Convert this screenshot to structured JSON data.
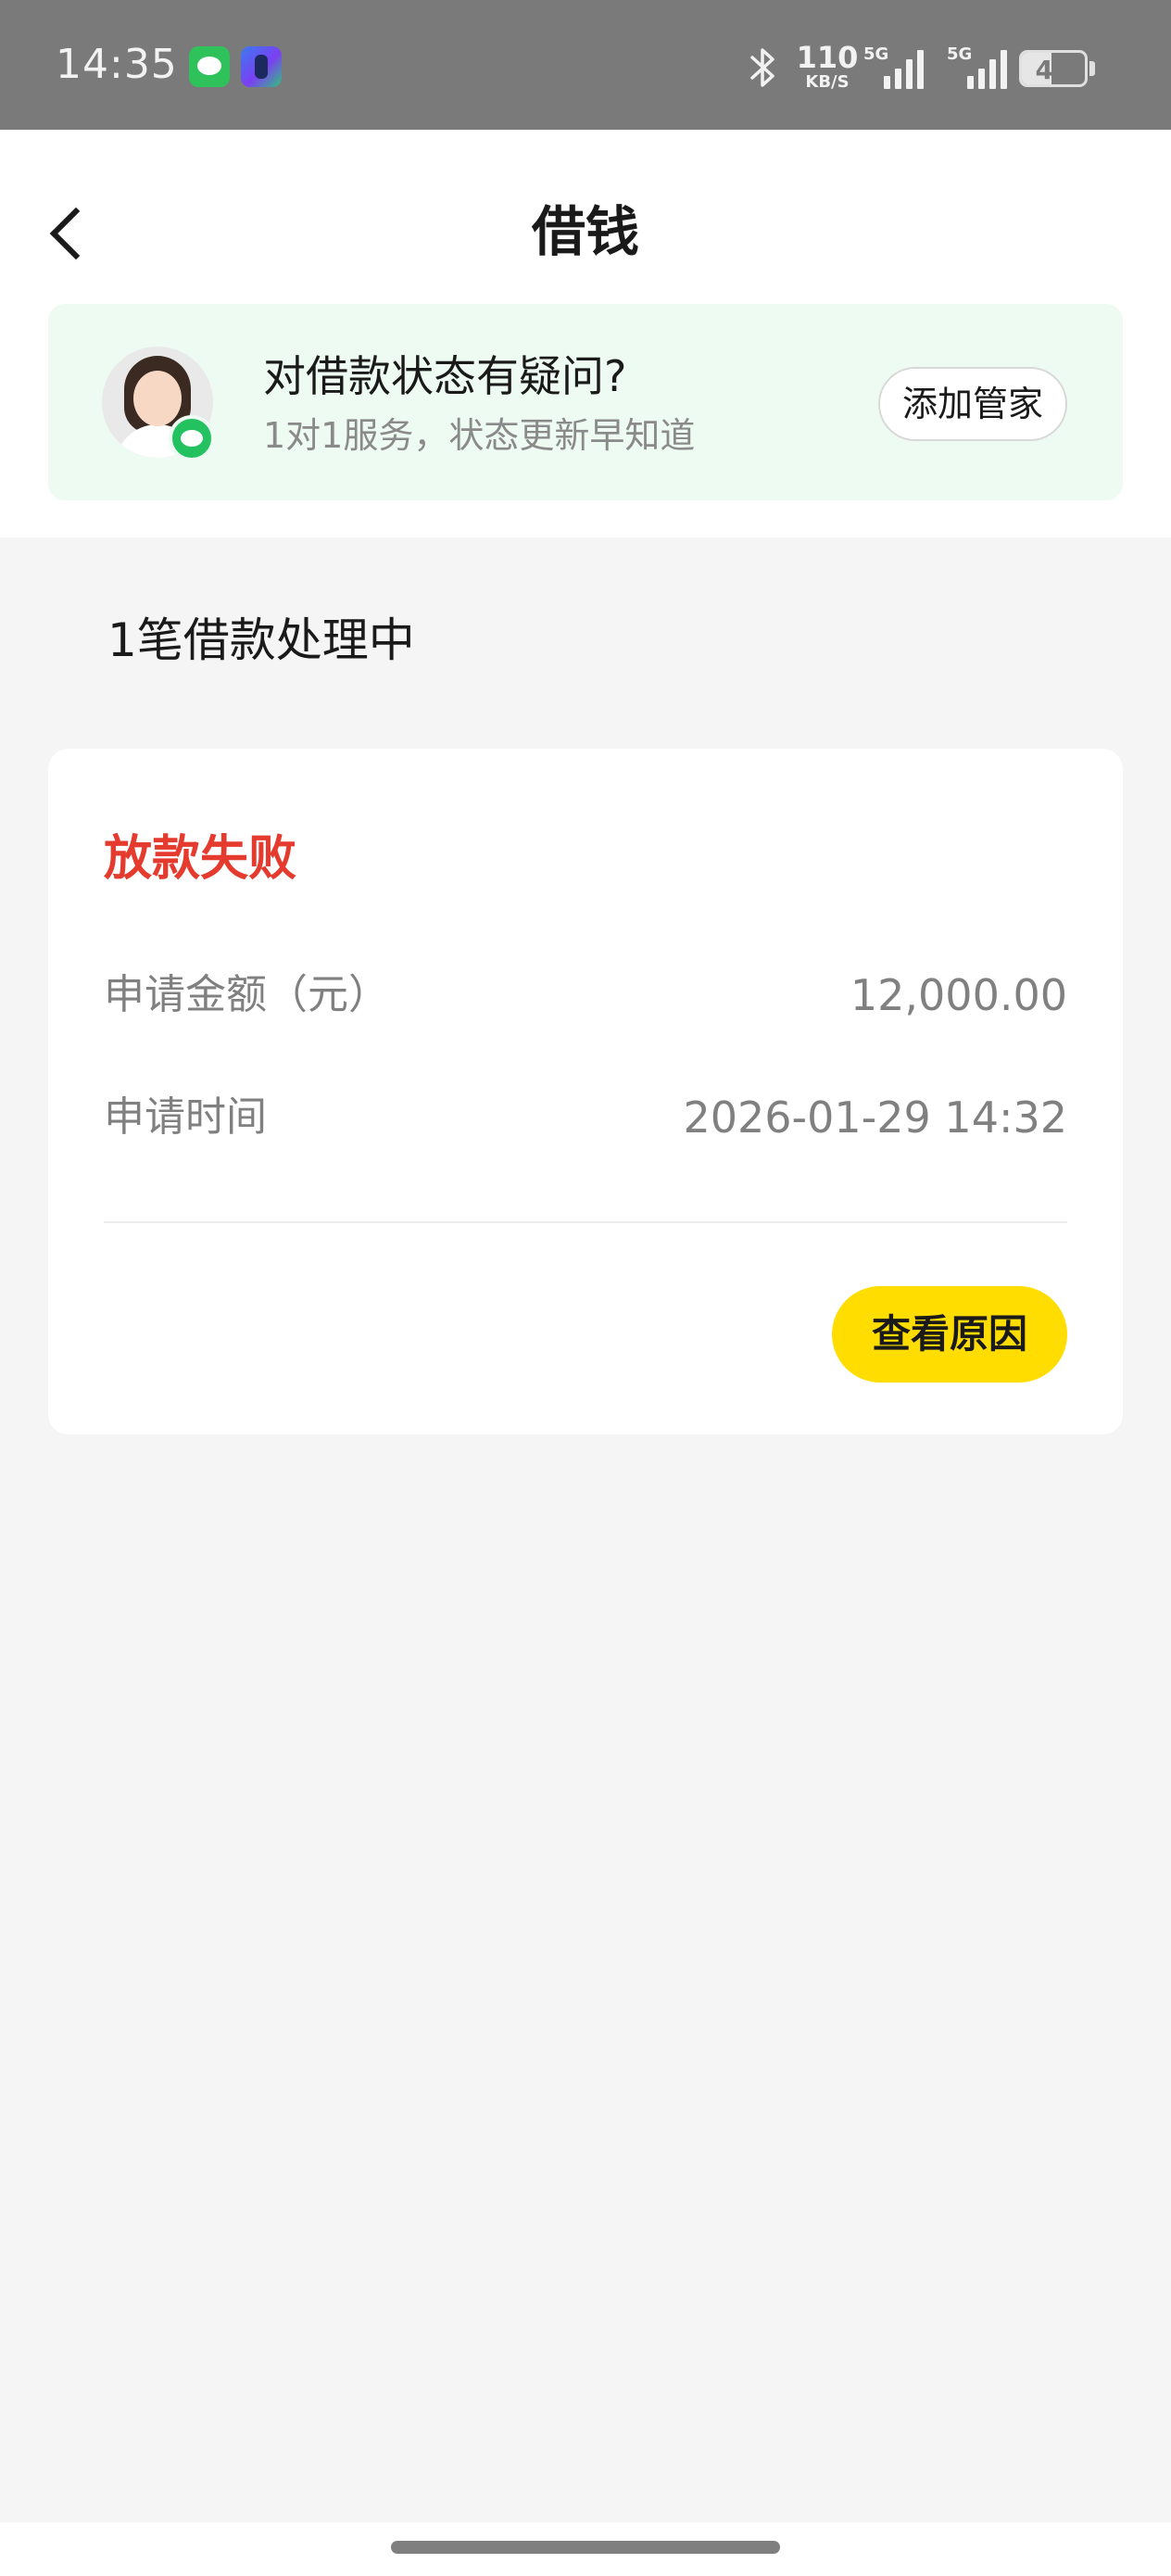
{
  "status_bar": {
    "time": "14:35",
    "network_speed": "110",
    "network_speed_unit": "KB/S",
    "signal_1_type": "5G",
    "signal_2_type": "5G",
    "battery_level": "47"
  },
  "header": {
    "title": "借钱"
  },
  "banner": {
    "title": "对借款状态有疑问?",
    "subtitle": "1对1服务，状态更新早知道",
    "button_label": "添加管家"
  },
  "section": {
    "title": "1笔借款处理中"
  },
  "loan_card": {
    "status": "放款失败",
    "status_color": "#e53b2e",
    "amount_label": "申请金额（元）",
    "amount_value": "12,000.00",
    "time_label": "申请时间",
    "time_value": "2026-01-29 14:32",
    "button_label": "查看原因",
    "button_color": "#ffdd00"
  }
}
